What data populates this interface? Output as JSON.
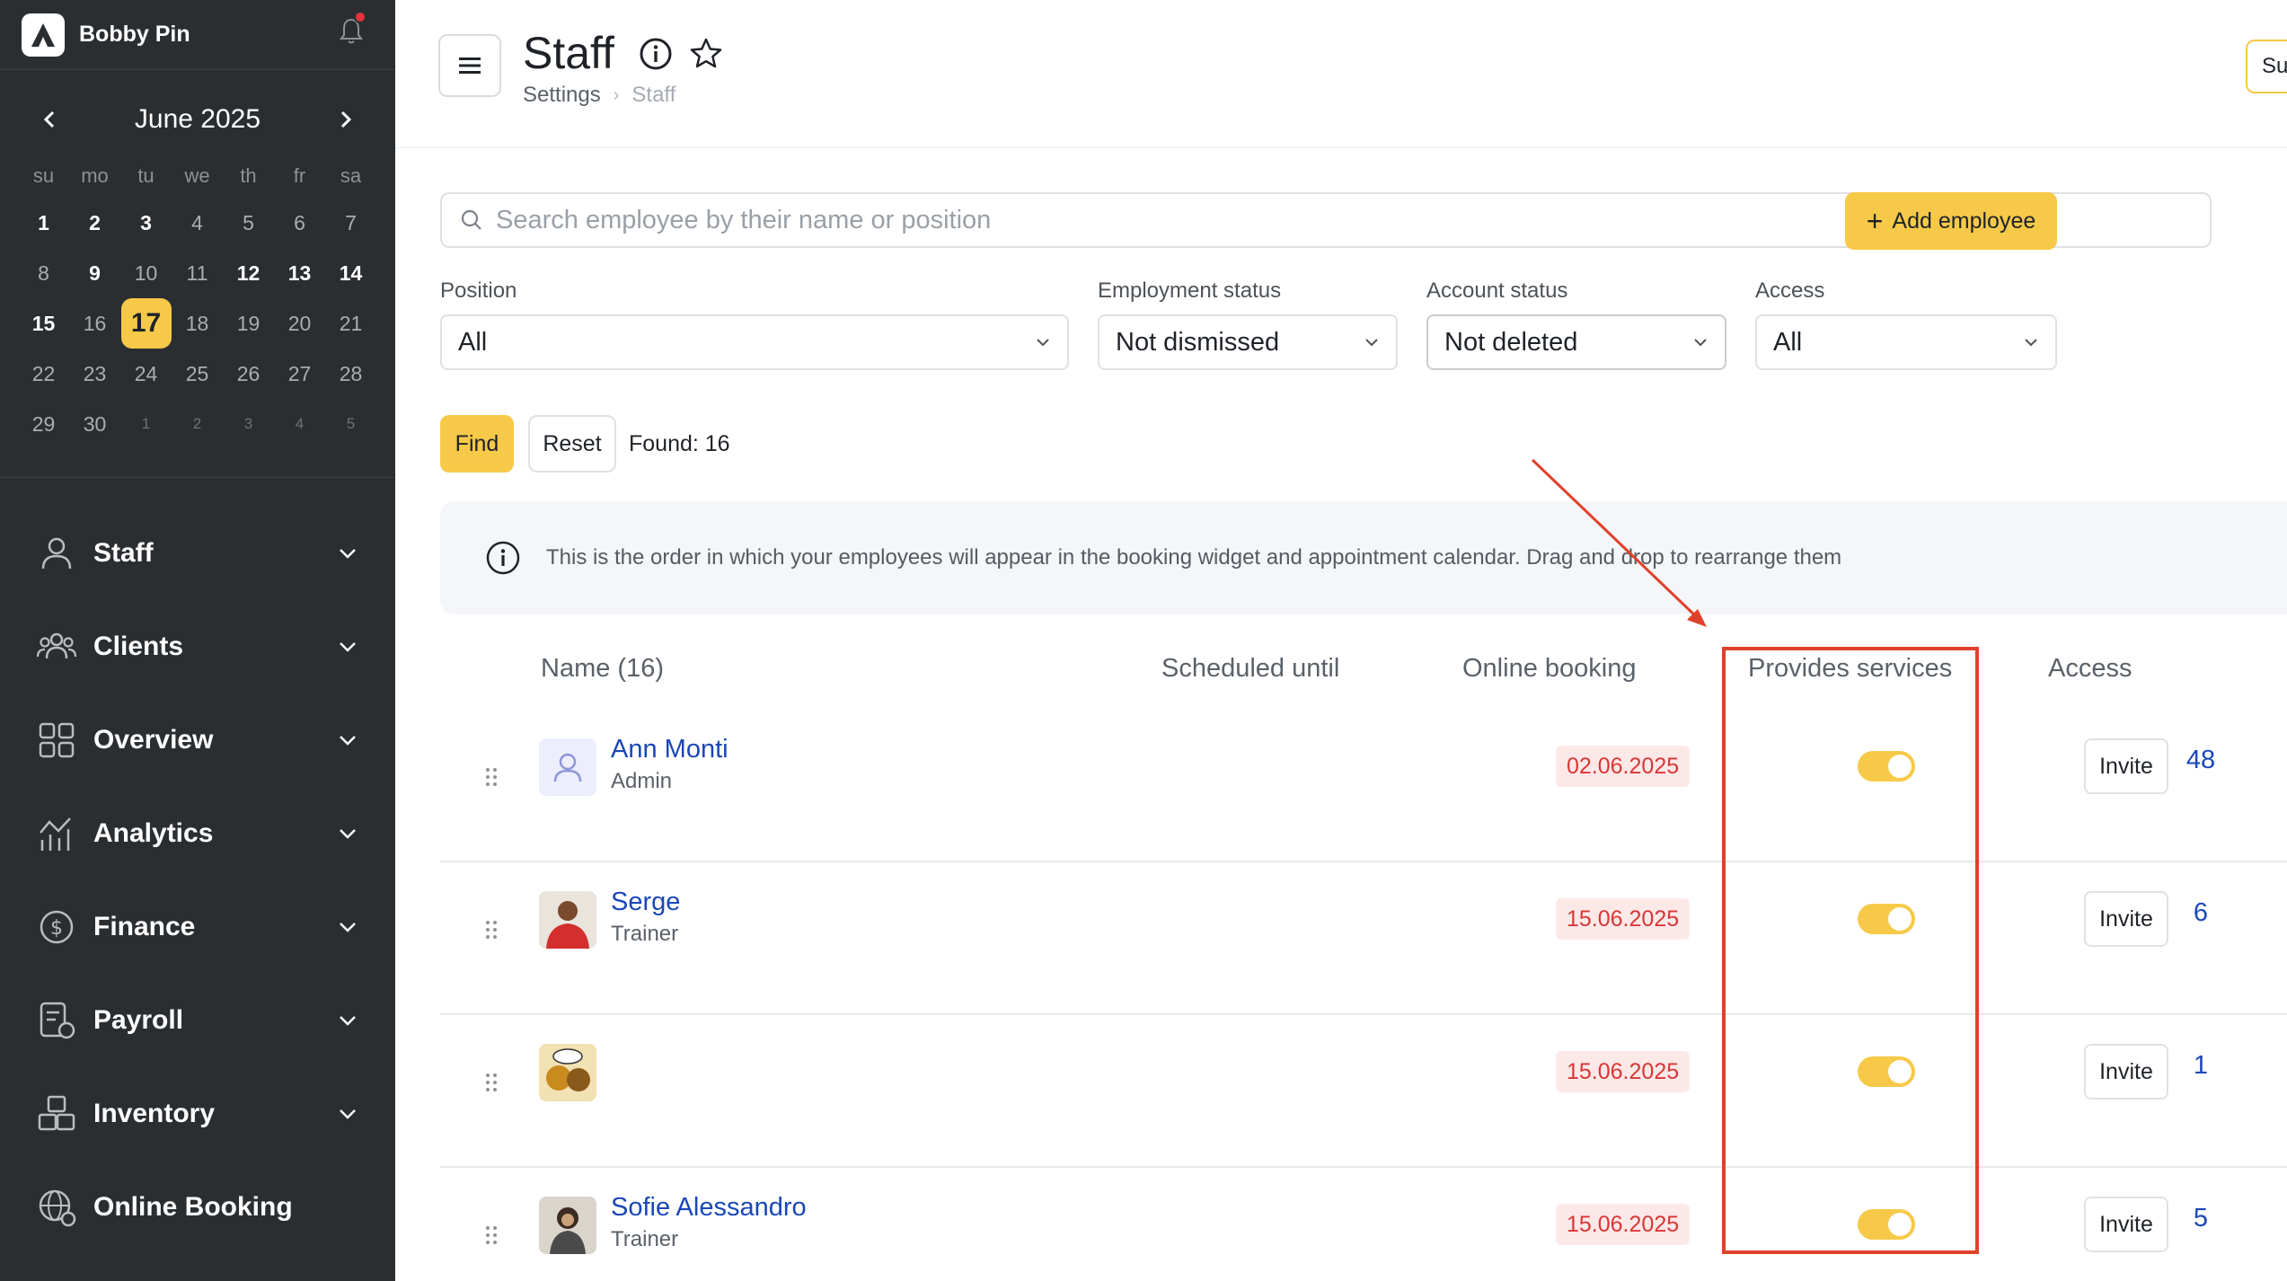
{
  "app": {
    "brand": "Bobby Pin"
  },
  "calendar": {
    "month": "June 2025",
    "weekdays": [
      "su",
      "mo",
      "tu",
      "we",
      "th",
      "fr",
      "sa"
    ],
    "days": [
      {
        "d": "1",
        "s": "bold"
      },
      {
        "d": "2",
        "s": "bold"
      },
      {
        "d": "3",
        "s": "bold"
      },
      {
        "d": "4",
        "s": "normal"
      },
      {
        "d": "5",
        "s": "normal"
      },
      {
        "d": "6",
        "s": "normal"
      },
      {
        "d": "7",
        "s": "normal"
      },
      {
        "d": "8",
        "s": "normal"
      },
      {
        "d": "9",
        "s": "bold"
      },
      {
        "d": "10",
        "s": "normal"
      },
      {
        "d": "11",
        "s": "normal"
      },
      {
        "d": "12",
        "s": "bold"
      },
      {
        "d": "13",
        "s": "bold"
      },
      {
        "d": "14",
        "s": "bold"
      },
      {
        "d": "15",
        "s": "bold"
      },
      {
        "d": "16",
        "s": "normal"
      },
      {
        "d": "17",
        "s": "today"
      },
      {
        "d": "18",
        "s": "normal"
      },
      {
        "d": "19",
        "s": "normal"
      },
      {
        "d": "20",
        "s": "normal"
      },
      {
        "d": "21",
        "s": "normal"
      },
      {
        "d": "22",
        "s": "normal"
      },
      {
        "d": "23",
        "s": "normal"
      },
      {
        "d": "24",
        "s": "normal"
      },
      {
        "d": "25",
        "s": "normal"
      },
      {
        "d": "26",
        "s": "normal"
      },
      {
        "d": "27",
        "s": "normal"
      },
      {
        "d": "28",
        "s": "normal"
      },
      {
        "d": "29",
        "s": "normal"
      },
      {
        "d": "30",
        "s": "normal"
      },
      {
        "d": "1",
        "s": "dim"
      },
      {
        "d": "2",
        "s": "dim"
      },
      {
        "d": "3",
        "s": "dim"
      },
      {
        "d": "4",
        "s": "dim"
      },
      {
        "d": "5",
        "s": "dim"
      }
    ]
  },
  "menu": {
    "items": [
      {
        "label": "Staff",
        "icon": "user-icon"
      },
      {
        "label": "Clients",
        "icon": "users-icon"
      },
      {
        "label": "Overview",
        "icon": "grid-icon"
      },
      {
        "label": "Analytics",
        "icon": "analytics-icon"
      },
      {
        "label": "Finance",
        "icon": "finance-icon"
      },
      {
        "label": "Payroll",
        "icon": "payroll-icon"
      },
      {
        "label": "Inventory",
        "icon": "inventory-icon"
      },
      {
        "label": "Online Booking",
        "icon": "globe-icon"
      }
    ]
  },
  "header": {
    "title": "Staff",
    "breadcrumb": [
      "Settings",
      "Staff"
    ],
    "right_button": "Su"
  },
  "search": {
    "placeholder": "Search employee by their name or position"
  },
  "actions": {
    "add_employee": "Add employee",
    "find": "Find",
    "reset": "Reset",
    "found": "Found: 16"
  },
  "filters": {
    "position": {
      "label": "Position",
      "value": "All"
    },
    "employment_status": {
      "label": "Employment status",
      "value": "Not dismissed"
    },
    "account_status": {
      "label": "Account status",
      "value": "Not deleted"
    },
    "access": {
      "label": "Access",
      "value": "All"
    }
  },
  "notice": {
    "text": "This is the order in which your employees will appear in the booking widget and appointment calendar. Drag and drop to rearrange them"
  },
  "table": {
    "columns": {
      "name": "Name (16)",
      "scheduled": "Scheduled until",
      "online": "Online booking",
      "services": "Provides services",
      "access": "Access"
    },
    "rows": [
      {
        "name": "Ann Monti",
        "position": "Admin",
        "scheduled": "02.06.2025",
        "online": true,
        "services": "48",
        "access": "Invite"
      },
      {
        "name": "Serge",
        "position": "Trainer",
        "scheduled": "15.06.2025",
        "online": true,
        "services": "6",
        "access": "Invite"
      },
      {
        "name": "",
        "position": "",
        "scheduled": "15.06.2025",
        "online": true,
        "services": "1",
        "access": "Invite"
      },
      {
        "name": "Sofie Alessandro",
        "position": "Trainer",
        "scheduled": "15.06.2025",
        "online": true,
        "services": "5",
        "access": "Invite"
      }
    ]
  },
  "colors": {
    "accent": "#f7c948",
    "sidebar": "#2b2e31",
    "link": "#1a47b8",
    "highlight": "#e0412b",
    "badge_bg": "#fde8e8",
    "badge_text": "#d93636"
  }
}
